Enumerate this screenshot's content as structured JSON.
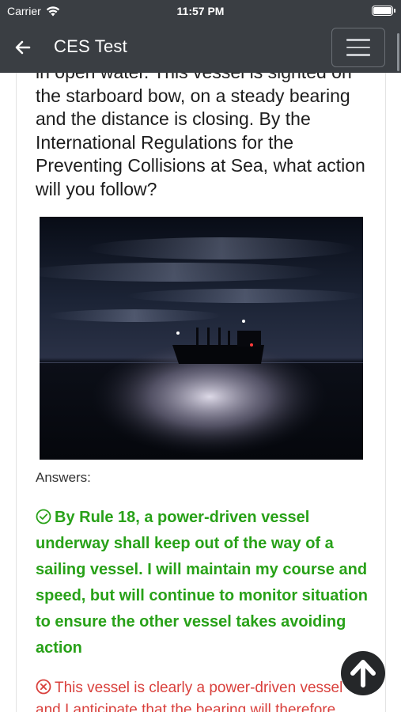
{
  "status_bar": {
    "carrier": "Carrier",
    "time": "11:57 PM"
  },
  "nav": {
    "title": "CES Test"
  },
  "question": {
    "text": "in open water. This vessel is sighted on the starboard bow, on a steady bearing and the distance is closing. By the International Regulations for the Preventing Collisions at Sea, what action will you follow?"
  },
  "answers_label": "Answers:",
  "answers": [
    {
      "status": "correct",
      "text": "By Rule 18, a power-driven vessel underway shall keep out of the way of a sailing vessel. I will maintain my course and speed, but will continue to monitor situation to ensure the other vessel takes avoiding action"
    },
    {
      "status": "wrong",
      "text": "This vessel is clearly a power-driven vessel and I anticipate that the bearing will therefore"
    }
  ],
  "colors": {
    "bar": "#3a3e43",
    "correct": "#28a118",
    "wrong": "#d9403c"
  },
  "icons": {
    "back": "arrow-left-icon",
    "menu": "hamburger-icon",
    "correct": "check-circle-icon",
    "wrong": "x-circle-icon",
    "scroll_top": "arrow-up-icon"
  }
}
